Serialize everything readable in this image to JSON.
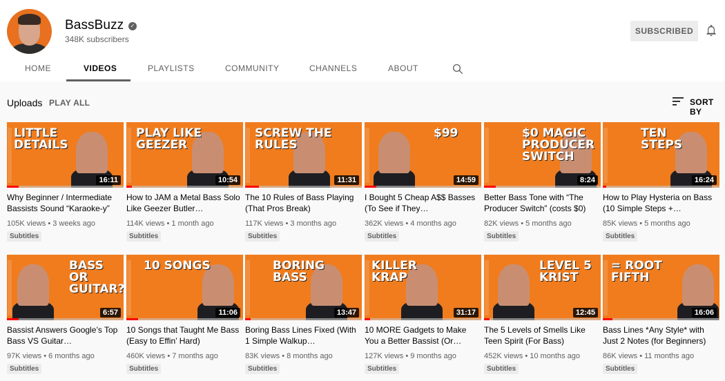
{
  "channel": {
    "name": "BassBuzz",
    "subscribers": "348K subscribers",
    "subscribe_label": "SUBSCRIBED",
    "verified_icon": "check-circle-icon"
  },
  "tabs": [
    {
      "label": "HOME"
    },
    {
      "label": "VIDEOS"
    },
    {
      "label": "PLAYLISTS"
    },
    {
      "label": "COMMUNITY"
    },
    {
      "label": "CHANNELS"
    },
    {
      "label": "ABOUT"
    }
  ],
  "active_tab": "VIDEOS",
  "toolbar": {
    "uploads_label": "Uploads",
    "play_all_label": "PLAY ALL",
    "sort_label": "SORT BY"
  },
  "colors": {
    "accent": "#ff0000",
    "thumbnail_bg": "#f07c1e"
  },
  "videos": [
    {
      "title": "Why Beginner / Intermediate Bassists Sound “Karaoke-y”",
      "views": "105K views",
      "age": "3 weeks ago",
      "duration": "16:11",
      "badge": "Subtitles",
      "thumb_text": [
        "LITTLE",
        "DETAILS"
      ],
      "watched": 0.1
    },
    {
      "title": "How to JAM a Metal Bass Solo Like Geezer Butler…",
      "views": "114K views",
      "age": "1 month ago",
      "duration": "10:54",
      "badge": "Subtitles",
      "thumb_text": [
        "PLAY LIKE",
        "GEEZER"
      ],
      "watched": 0.05
    },
    {
      "title": "The 10 Rules of Bass Playing (That Pros Break)",
      "views": "117K views",
      "age": "3 months ago",
      "duration": "11:31",
      "badge": "Subtitles",
      "thumb_text": [
        "SCREW THE RULES"
      ],
      "watched": 0.12
    },
    {
      "title": "I Bought 5 Cheap A$$ Basses (To See if They…",
      "views": "362K views",
      "age": "4 months ago",
      "duration": "14:59",
      "badge": "Subtitles",
      "thumb_text": [
        "$99"
      ],
      "watched": 0.1
    },
    {
      "title": "Better Bass Tone with “The Producer Switch” (costs $0)",
      "views": "82K views",
      "age": "5 months ago",
      "duration": "8:24",
      "badge": "Subtitles",
      "thumb_text": [
        "$0 MAGIC",
        "PRODUCER",
        "SWITCH"
      ],
      "watched": 0.1
    },
    {
      "title": "How to Play Hysteria on Bass (10 Simple Steps +…",
      "views": "85K views",
      "age": "5 months ago",
      "duration": "16:24",
      "badge": "Subtitles",
      "thumb_text": [
        "TEN",
        "STEPS"
      ],
      "watched": 0.03
    },
    {
      "title": "Bassist Answers Google’s Top Bass VS Guitar…",
      "views": "97K views",
      "age": "6 months ago",
      "duration": "6:57",
      "badge": "Subtitles",
      "thumb_text": [
        "BASS OR",
        "GUITAR?"
      ],
      "watched": 0.1
    },
    {
      "title": "10 Songs that Taught Me Bass (Easy to Effin’ Hard)",
      "views": "460K views",
      "age": "7 months ago",
      "duration": "11:06",
      "badge": "Subtitles",
      "thumb_text": [
        "10 SONGS"
      ],
      "watched": 0.1
    },
    {
      "title": "Boring Bass Lines Fixed (With 1 Simple Walkup…",
      "views": "83K views",
      "age": "8 months ago",
      "duration": "13:47",
      "badge": "Subtitles",
      "thumb_text": [
        "BORING",
        "BASS"
      ],
      "watched": 0.05
    },
    {
      "title": "10 MORE Gadgets to Make You a Better Bassist (Or…",
      "views": "127K views",
      "age": "9 months ago",
      "duration": "31:17",
      "badge": "Subtitles",
      "thumb_text": [
        "KILLER",
        "KRAP"
      ],
      "watched": 0.05
    },
    {
      "title": "The 5 Levels of Smells Like Teen Spirit (For Bass)",
      "views": "452K views",
      "age": "10 months ago",
      "duration": "12:45",
      "badge": "Subtitles",
      "thumb_text": [
        "LEVEL 5",
        "KRIST"
      ],
      "watched": 0.05
    },
    {
      "title": "Bass Lines *Any Style* with Just 2 Notes (for Beginners)",
      "views": "86K views",
      "age": "11 months ago",
      "duration": "16:06",
      "badge": "Subtitles",
      "thumb_text": [
        "= ROOT",
        "FIFTH"
      ],
      "watched": 0.08
    }
  ]
}
